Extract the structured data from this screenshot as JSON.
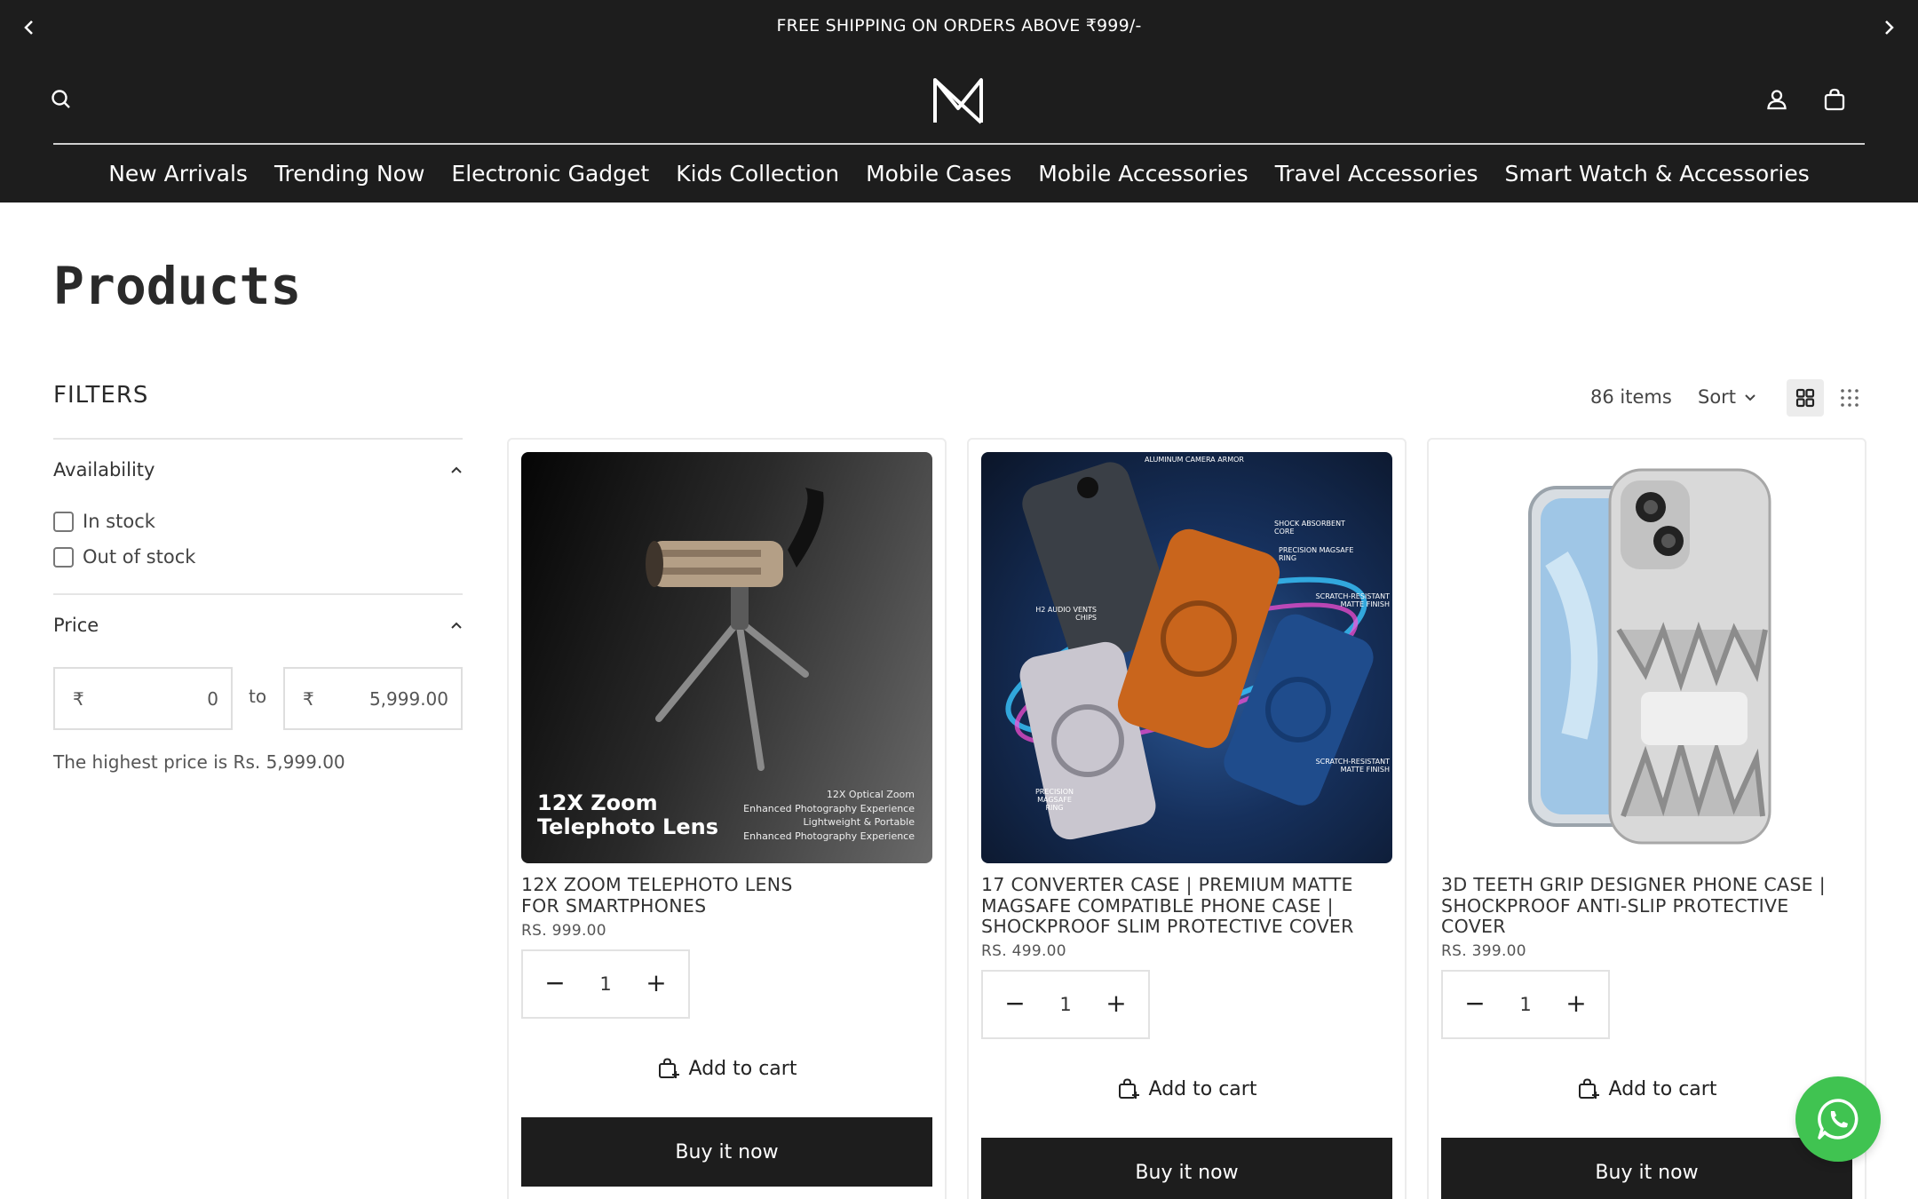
{
  "announcement": {
    "text": "FREE SHIPPING ON ORDERS ABOVE ₹999/-"
  },
  "header": {
    "search_icon": "search-icon",
    "logo_icon": "brand-logo-m",
    "account_icon": "user-icon",
    "cart_icon": "shopping-bag-icon"
  },
  "nav": {
    "items": [
      {
        "label": "New Arrivals"
      },
      {
        "label": "Trending Now"
      },
      {
        "label": "Electronic Gadget"
      },
      {
        "label": "Kids Collection"
      },
      {
        "label": "Mobile Cases"
      },
      {
        "label": "Mobile Accessories"
      },
      {
        "label": "Travel Accessories"
      },
      {
        "label": "Smart Watch & Accessories"
      }
    ]
  },
  "page": {
    "title": "Products"
  },
  "filters": {
    "title": "FILTERS",
    "availability": {
      "label": "Availability",
      "options": [
        {
          "label": "In stock"
        },
        {
          "label": "Out of stock"
        }
      ]
    },
    "price": {
      "label": "Price",
      "currency": "₹",
      "min_value": "0",
      "max_value": "5,999.00",
      "to_label": "to",
      "note": "The highest price is Rs. 5,999.00"
    }
  },
  "toolbar": {
    "count": "86 items",
    "sort_label": "Sort"
  },
  "products": [
    {
      "title": "12X ZOOM TELEPHOTO LENS FOR SMARTPHONES",
      "price": "RS. 999.00",
      "qty": "1",
      "add_to_cart": "Add to cart",
      "buy_now": "Buy it now",
      "image": {
        "headline_1": "12X Zoom",
        "headline_2": "Telephoto Lens",
        "bullets": [
          "12X Optical Zoom",
          "Enhanced Photography Experience",
          "Lightweight & Portable",
          "Enhanced Photography Experience"
        ]
      }
    },
    {
      "title": "17 CONVERTER CASE | PREMIUM MATTE MAGSAFE COMPATIBLE PHONE CASE | SHOCKPROOF SLIM PROTECTIVE COVER",
      "price": "RS. 499.00",
      "qty": "1",
      "add_to_cart": "Add to cart",
      "buy_now": "Buy it now",
      "image": {
        "callouts": [
          "ALUMINUM CAMERA ARMOR",
          "SHOCK ABSORBENT CORE",
          "PRECISION MAGSAFE RING",
          "SCRATCH-RESISTANT MATTE FINISH",
          "H2 AUDIO VENTS CHIPS",
          "SCRATCH-RESISTANT MATTE FINISH",
          "PRECISION MAGSAFE RING"
        ]
      }
    },
    {
      "title": "3D TEETH GRIP DESIGNER PHONE CASE | SHOCKPROOF ANTI-SLIP PROTECTIVE COVER",
      "price": "RS. 399.00",
      "qty": "1",
      "add_to_cart": "Add to cart",
      "buy_now": "Buy it now"
    }
  ],
  "floating": {
    "whatsapp_icon": "whatsapp-icon"
  },
  "colors": {
    "header_bg": "#1d1d1d",
    "button_bg": "#1d1d1d",
    "whatsapp_green": "#40c351"
  }
}
